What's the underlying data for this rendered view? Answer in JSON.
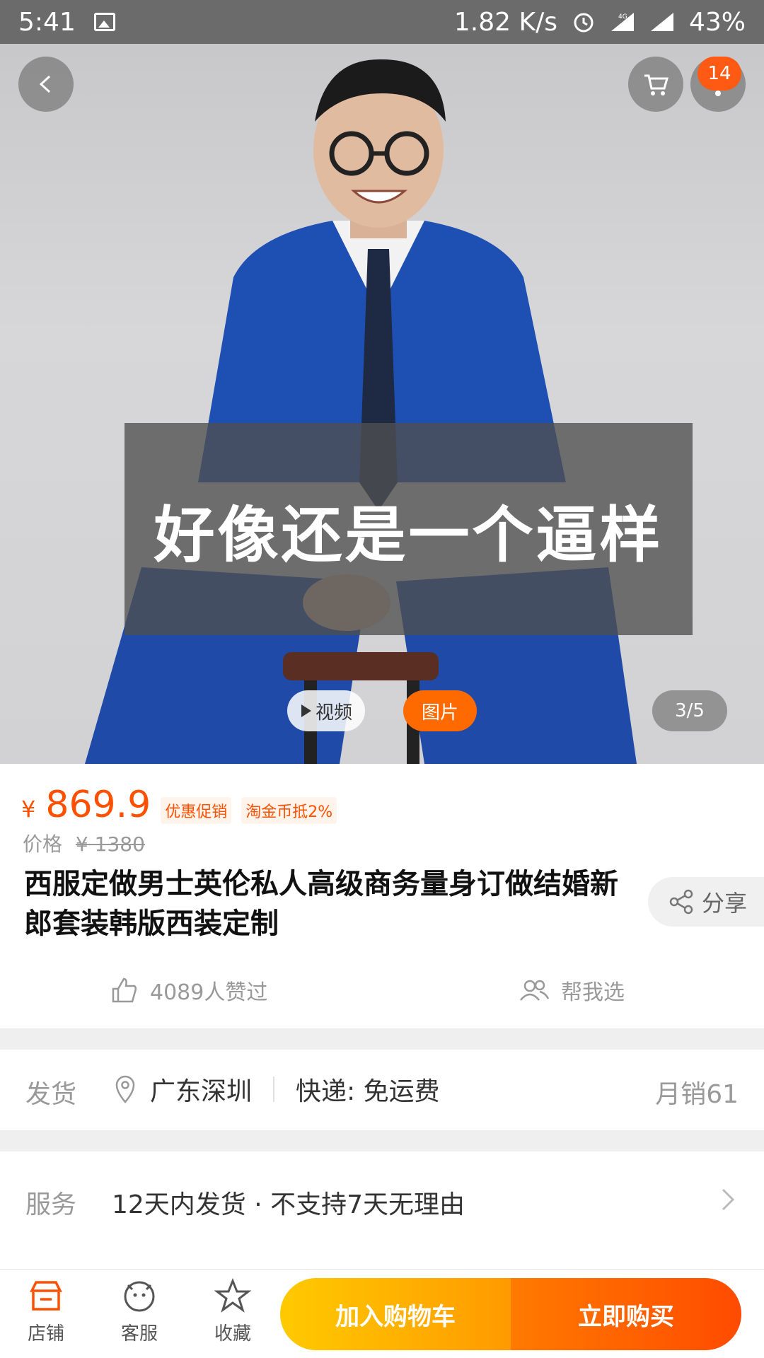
{
  "status_bar": {
    "time": "5:41",
    "net_speed": "1.82 K/s",
    "network": "4G",
    "battery": "43%",
    "icons": [
      "image-icon",
      "alarm-icon",
      "signal-icon",
      "signal-icon"
    ]
  },
  "gallery": {
    "overlay_text": "好像还是一个逼样",
    "video_label": "视频",
    "image_label": "图片",
    "counter": "3/5",
    "cart_badge": "14",
    "icons": [
      "back-icon",
      "cart-icon",
      "more-icon"
    ]
  },
  "price": {
    "currency": "¥",
    "value": "869.9",
    "tags": [
      "优惠促销",
      "淘金币抵2%"
    ],
    "original_label": "价格",
    "original_value": "¥ 1380"
  },
  "product": {
    "title": "西服定做男士英伦私人高级商务量身订做结婚新郎套装韩版西装定制",
    "share_label": "分享",
    "likes": "4089人赞过",
    "help_choose": "帮我选"
  },
  "shipping": {
    "label": "发货",
    "location": "广东深圳",
    "express": "快递: 免运费",
    "monthly_sales": "月销61"
  },
  "service": {
    "label": "服务",
    "text": "12天内发货 · 不支持7天无理由"
  },
  "bottom_bar": {
    "store": "店铺",
    "support": "客服",
    "favorite": "收藏",
    "add_to_cart": "加入购物车",
    "buy_now": "立即购买"
  },
  "colors": {
    "accent": "#ff5000",
    "cart_button": "#ffb000",
    "buy_button": "#ff5a00"
  }
}
